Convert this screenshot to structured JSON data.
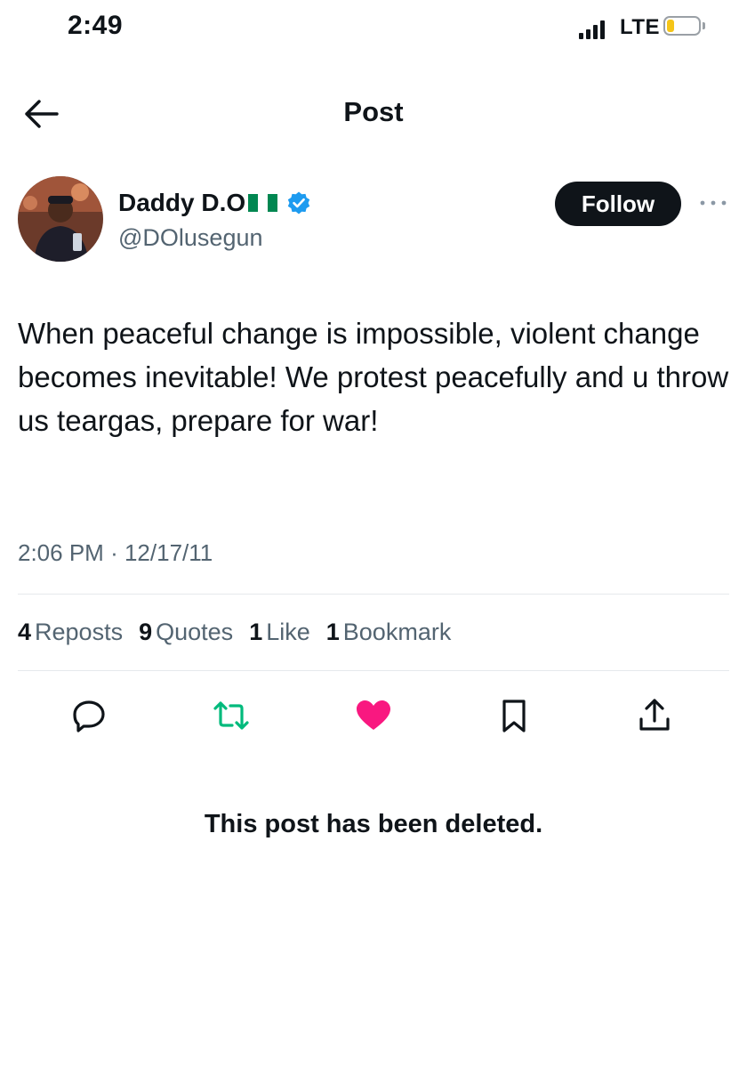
{
  "status_bar": {
    "time": "2:49",
    "network": "LTE",
    "battery_color": "#f5c518"
  },
  "header": {
    "title": "Post",
    "back_icon": "arrow-left-icon"
  },
  "author": {
    "name": "Daddy D.O",
    "flag": "nigeria-flag-icon",
    "verified_icon": "verified-badge-icon",
    "handle": "@DOlusegun",
    "follow_label": "Follow"
  },
  "post": {
    "text": "When peaceful change is impossible, violent change becomes inevitable! We protest peacefully and u throw us teargas, prepare for war!",
    "time": "2:06 PM",
    "separator": "·",
    "date": "12/17/11"
  },
  "stats": [
    {
      "count": "4",
      "label": "Reposts"
    },
    {
      "count": "9",
      "label": "Quotes"
    },
    {
      "count": "1",
      "label": "Like"
    },
    {
      "count": "1",
      "label": "Bookmark"
    }
  ],
  "actions": {
    "reply_icon": "reply-bubble-icon",
    "repost_icon": "repost-icon",
    "like_icon": "heart-icon",
    "bookmark_icon": "bookmark-icon",
    "share_icon": "share-icon"
  },
  "colors": {
    "repost": "#00ba7c",
    "like": "#f91880",
    "verified": "#1d9bf0",
    "flag_green": "#008751"
  },
  "notice": "This post has been deleted."
}
